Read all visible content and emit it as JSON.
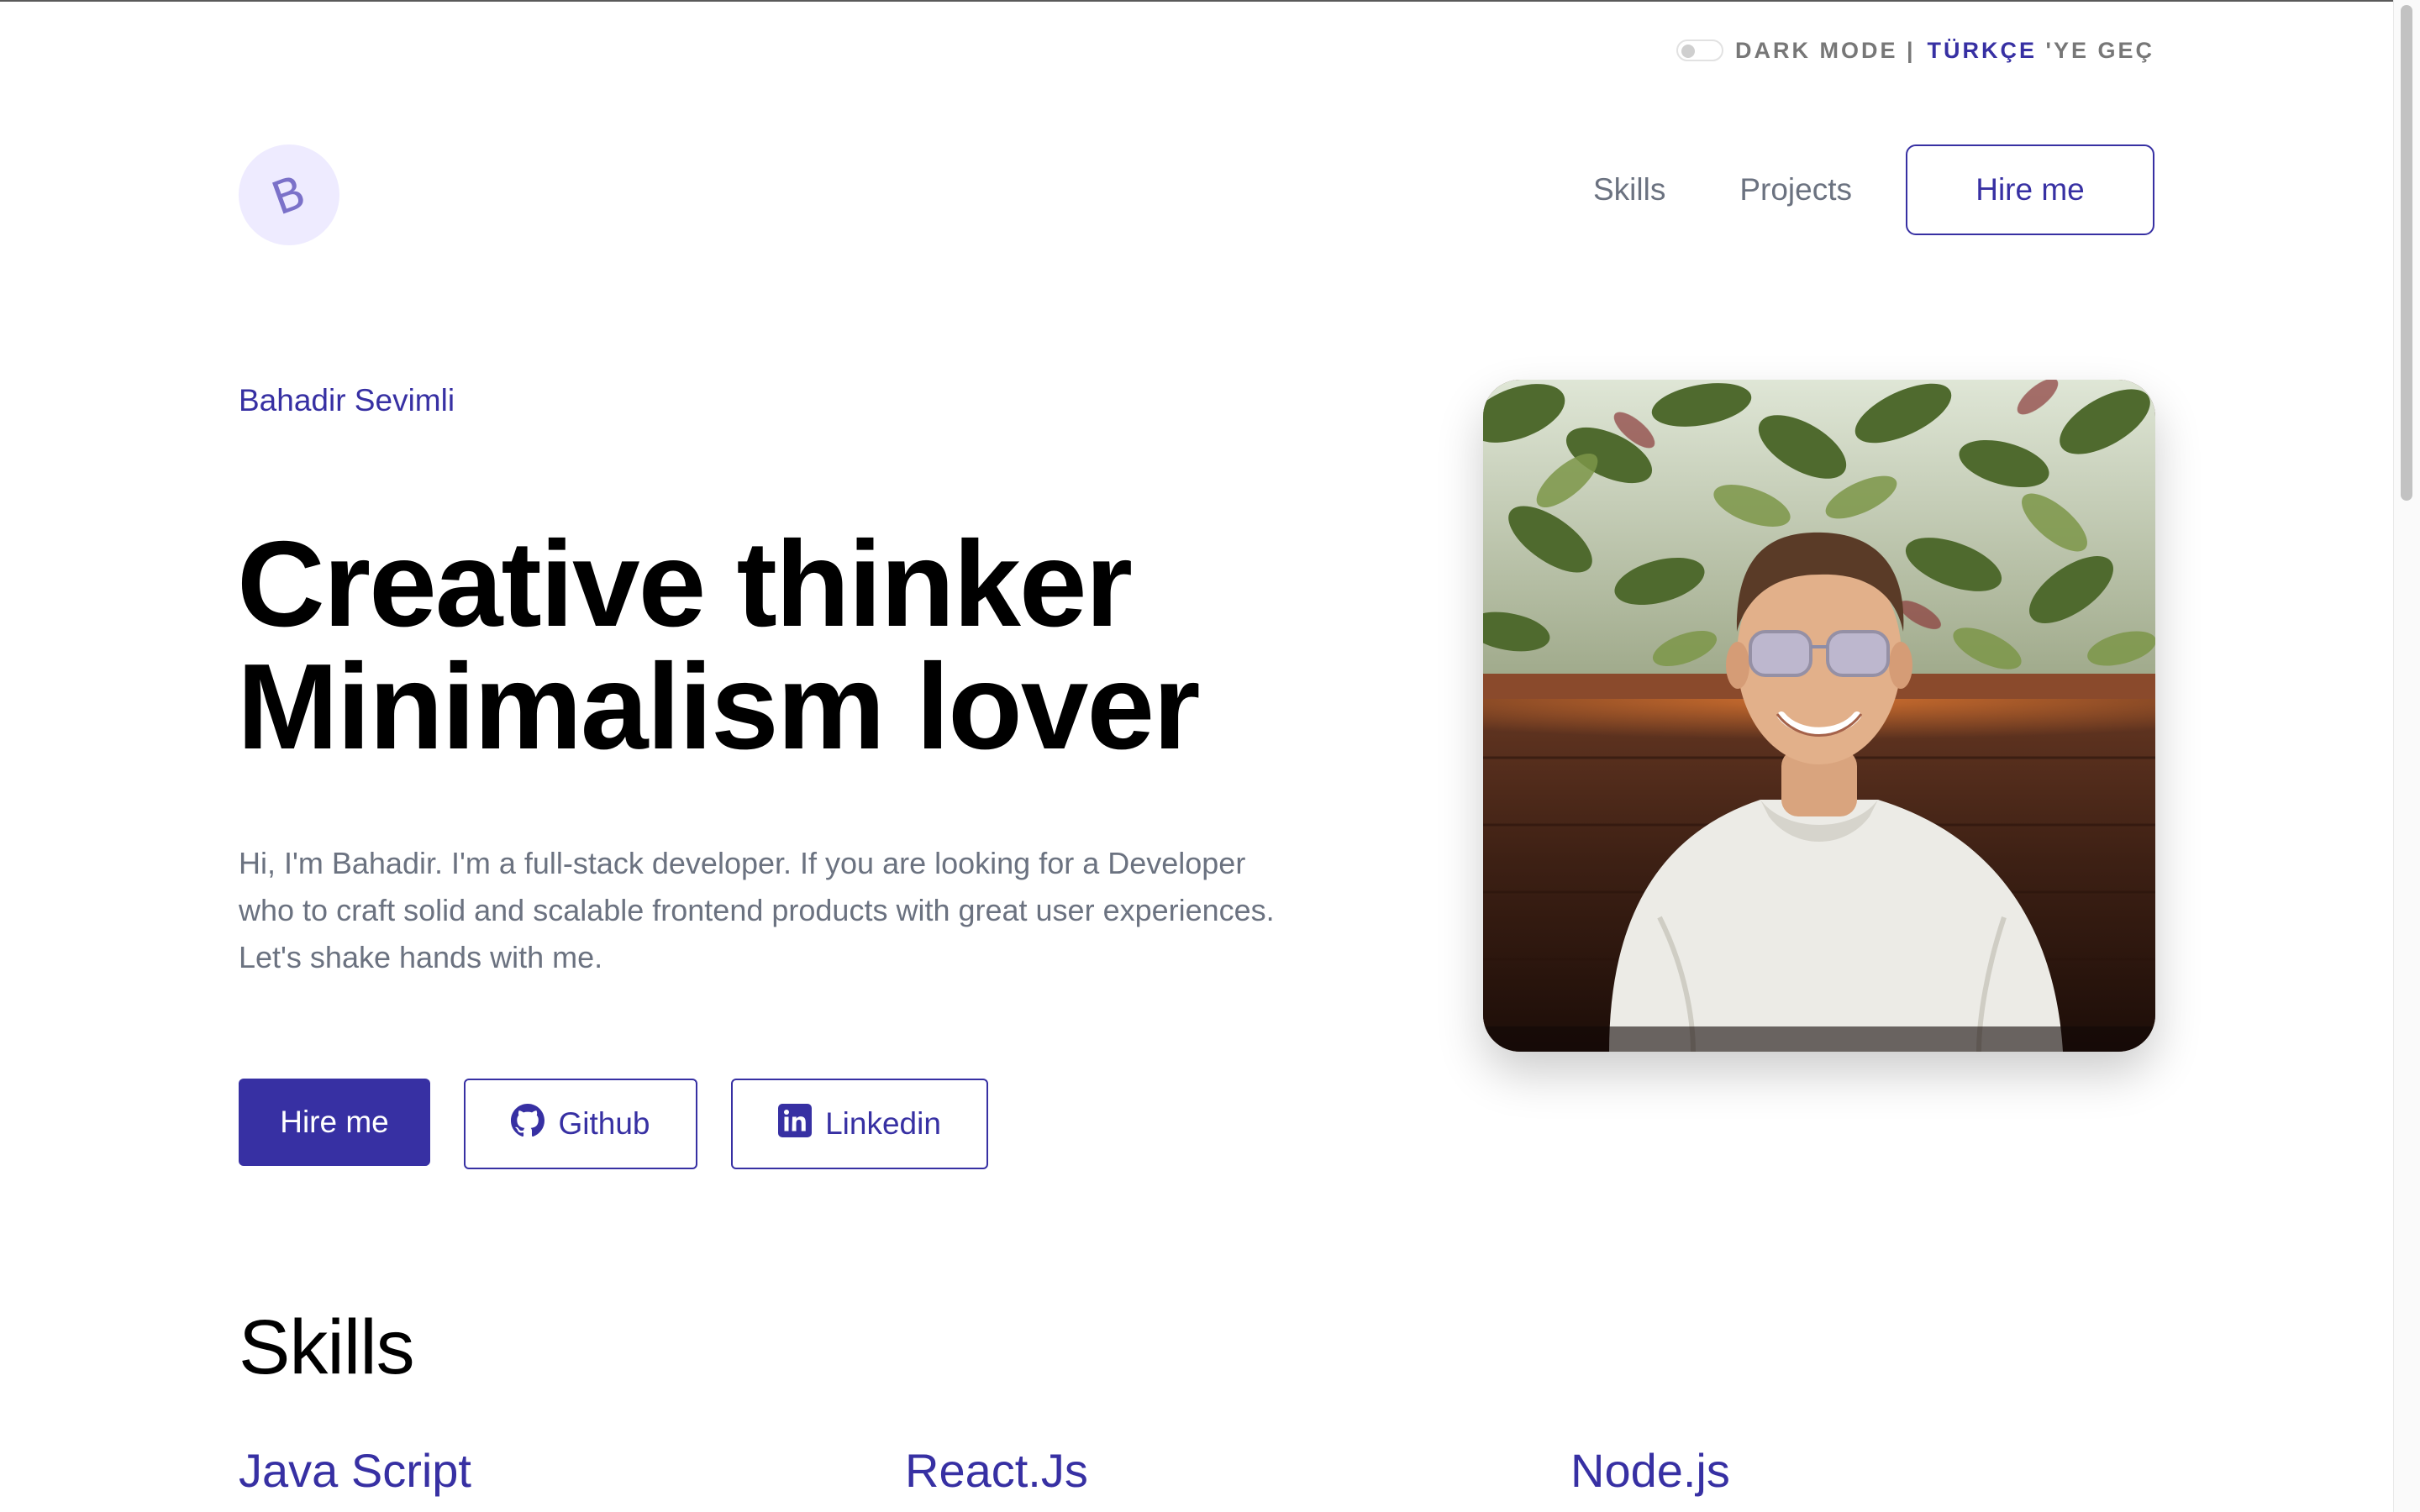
{
  "utility": {
    "dark_mode_label": "DARK MODE |",
    "lang_highlight": "TÜRKÇE",
    "lang_rest": "'YE GEÇ"
  },
  "header": {
    "logo_letter": "B",
    "nav": {
      "skills": "Skills",
      "projects": "Projects",
      "hire": "Hire me"
    }
  },
  "hero": {
    "name": "Bahadir Sevimli",
    "title_line1": "Creative thinker",
    "title_line2": "Minimalism lover",
    "intro": "Hi, I'm Bahadir. I'm a full-stack developer. If you are looking for a Developer who to craft solid and scalable frontend products with great user experiences. Let's shake hands with me.",
    "buttons": {
      "hire": "Hire me",
      "github": "Github",
      "linkedin": "Linkedin"
    }
  },
  "skills": {
    "title": "Skills",
    "items": [
      "Java Script",
      "React.Js",
      "Node.js"
    ]
  },
  "colors": {
    "accent": "#3730a3",
    "muted_text": "#6b7280",
    "logo_bg": "#eeebff"
  },
  "icons": [
    "github-icon",
    "linkedin-icon"
  ]
}
